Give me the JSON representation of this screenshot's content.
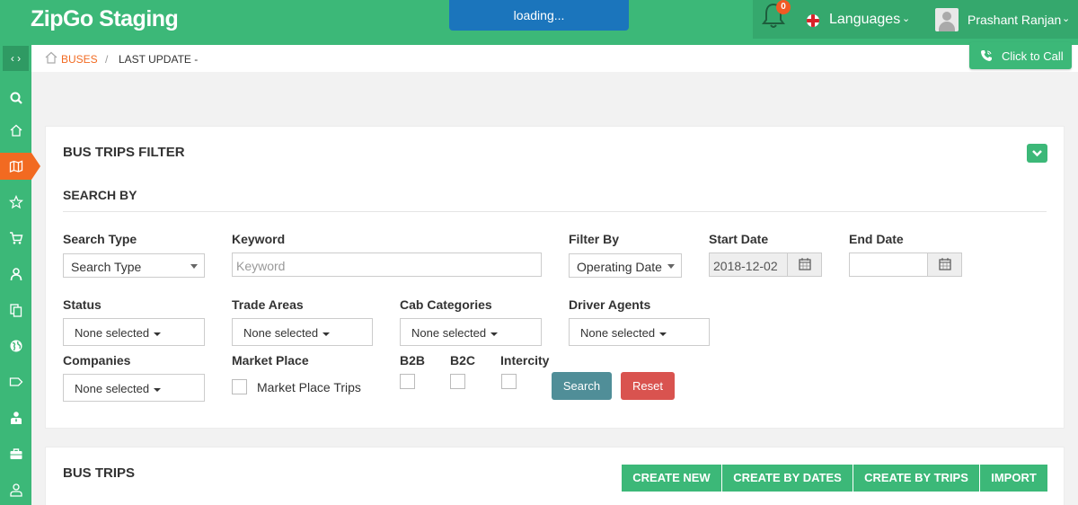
{
  "header": {
    "brand": "ZipGo Staging",
    "loading": "loading...",
    "notification_count": "0",
    "languages_label": "Languages",
    "user_name": "Prashant Ranjan"
  },
  "breadcrumb": {
    "current": "BUSES",
    "separator": "/",
    "last_update": "LAST UPDATE -"
  },
  "call_button": "Click to Call",
  "sidebar": {
    "icons": [
      "search-icon",
      "home-icon",
      "map-icon",
      "star-icon",
      "cart-icon",
      "user-icon",
      "copy-icon",
      "globe-icon",
      "tag-icon",
      "agent-icon",
      "briefcase-icon",
      "person-icon"
    ],
    "active_index": 2
  },
  "filter": {
    "title": "BUS TRIPS FILTER",
    "subtitle": "SEARCH BY",
    "search_type": {
      "label": "Search Type",
      "value": "Search Type"
    },
    "keyword": {
      "label": "Keyword",
      "placeholder": "Keyword"
    },
    "filter_by": {
      "label": "Filter By",
      "value": "Operating Date"
    },
    "start_date": {
      "label": "Start Date",
      "value": "2018-12-02"
    },
    "end_date": {
      "label": "End Date",
      "value": ""
    },
    "status": {
      "label": "Status",
      "value": "None selected"
    },
    "trade_areas": {
      "label": "Trade Areas",
      "value": "None selected"
    },
    "cab_categories": {
      "label": "Cab Categories",
      "value": "None selected"
    },
    "driver_agents": {
      "label": "Driver Agents",
      "value": "None selected"
    },
    "companies": {
      "label": "Companies",
      "value": "None selected"
    },
    "market_place": {
      "label": "Market Place",
      "option": "Market Place Trips"
    },
    "b2b": "B2B",
    "b2c": "B2C",
    "intercity": "Intercity",
    "search_button": "Search",
    "reset_button": "Reset"
  },
  "trips": {
    "title": "BUS TRIPS",
    "buttons": [
      "CREATE NEW",
      "CREATE BY DATES",
      "CREATE BY TRIPS",
      "IMPORT"
    ]
  },
  "colors": {
    "brand_green": "#3cb878",
    "accent_orange": "#f26a21",
    "loading_blue": "#1b75bc",
    "reset_red": "#d9534f",
    "search_teal": "#508e98"
  }
}
